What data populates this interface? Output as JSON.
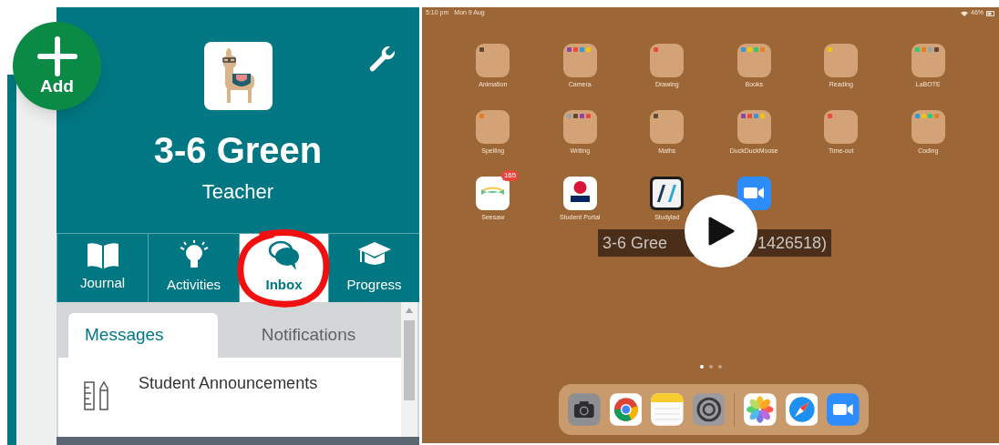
{
  "app": {
    "add_button": "Add",
    "class_name": "3-6 Green",
    "role": "Teacher",
    "nav_tabs": [
      {
        "label": "Journal",
        "kind": "book",
        "selected": false
      },
      {
        "label": "Activities",
        "kind": "bulb",
        "selected": false
      },
      {
        "label": "Inbox",
        "kind": "chat",
        "selected": true
      },
      {
        "label": "Progress",
        "kind": "cap",
        "selected": false
      }
    ],
    "inbox_tabs": [
      {
        "label": "Messages",
        "selected": true
      },
      {
        "label": "Notifications",
        "selected": false
      }
    ],
    "messages": [
      {
        "title": "Student Announcements"
      }
    ]
  },
  "video": {
    "status_bar": {
      "time": "5:10 pm",
      "date": "Mon 9 Aug",
      "battery": "46%"
    },
    "folders": [
      {
        "label": "Animation"
      },
      {
        "label": "Camera"
      },
      {
        "label": "Drawing"
      },
      {
        "label": "Books"
      },
      {
        "label": "Reading"
      },
      {
        "label": "LaBOTE"
      },
      {
        "label": "Spelling"
      },
      {
        "label": "Writing"
      },
      {
        "label": "Maths"
      },
      {
        "label": "DuckDuckMoose"
      },
      {
        "label": "Time-out"
      },
      {
        "label": "Coding"
      }
    ],
    "apps": [
      {
        "label": "Seesaw",
        "kind": "seesaw",
        "badge": "165"
      },
      {
        "label": "Student Portal",
        "kind": "nsw"
      },
      {
        "label": "Studylad",
        "kind": "studyladder"
      },
      {
        "kind": "zoom"
      }
    ],
    "caption": [
      "3-6 Gree",
      "1426518)"
    ]
  }
}
